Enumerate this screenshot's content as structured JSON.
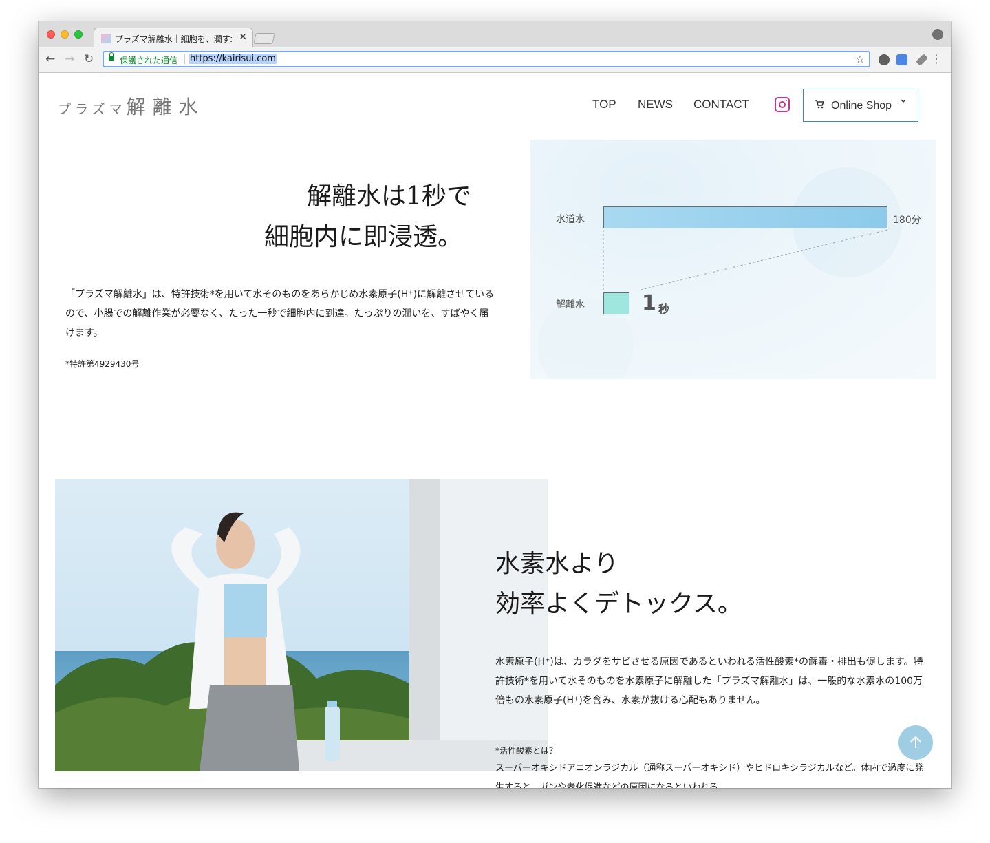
{
  "browser": {
    "tab_title": "プラズマ解離水｜細胞を、潤す水｜",
    "tab_close": "✕",
    "back": "←",
    "forward": "→",
    "reload": "↻",
    "secure_label": "保護された通信",
    "url": "https://kairisui.com",
    "star": "☆",
    "menu": "⋮",
    "icons": [
      "back-icon",
      "forward-icon",
      "reload-icon",
      "lock-icon",
      "star-icon",
      "wordpress-icon",
      "translate-icon",
      "eyedropper-icon",
      "menu-icon"
    ]
  },
  "header": {
    "logo_small": "プラズマ",
    "logo_big": "解離水",
    "nav": [
      "TOP",
      "NEWS",
      "CONTACT"
    ],
    "shop_label": "Online Shop",
    "cart_icon": "cart-icon",
    "chevron_icon": "chevron-down-icon",
    "instagram_icon": "instagram-icon",
    "instagram_color": "#c23a8e"
  },
  "section1": {
    "heading_line1": "解離水は1秒で",
    "heading_line2": "細胞内に即浸透。",
    "paragraph": "「プラズマ解離水」は、特許技術*を用いて水そのものをあらかじめ水素原子(H⁺)に解離させているので、小腸での解離作業が必要なく、たった一秒で細胞内に到達。たっぷりの潤いを、すばやく届けます。",
    "footnote": "*特許第4929430号"
  },
  "chart_data": {
    "type": "bar",
    "orientation": "horizontal",
    "categories": [
      "水道水",
      "解離水"
    ],
    "labels": [
      "180分",
      "1秒"
    ],
    "value_num": "1",
    "value_unit": "秒",
    "colors": [
      "#a8d9f1",
      "#9fe6df"
    ]
  },
  "section2": {
    "heading_line1": "水素水より",
    "heading_line2": "効率よくデトックス。",
    "paragraph": "水素原子(H⁺)は、カラダをサビさせる原因であるといわれる活性酸素*の解毒・排出も促します。特許技術*を用いて水そのものを水素原子に解離した「プラズマ解離水」は、一般的な水素水の100万倍もの水素原子(H⁺)を含み、水素が抜ける心配もありません。",
    "note_title": "*活性酸素とは？",
    "note_text": "スーパーオキシドアニオンラジカル（通称スーパーオキシド）やヒドロキシラジカルなど。体内で過度に発生すると、ガンや老化促進などの原因になるといわれる。",
    "photo_icon": "woman-stretching-photo"
  },
  "scroll_top": "↑"
}
